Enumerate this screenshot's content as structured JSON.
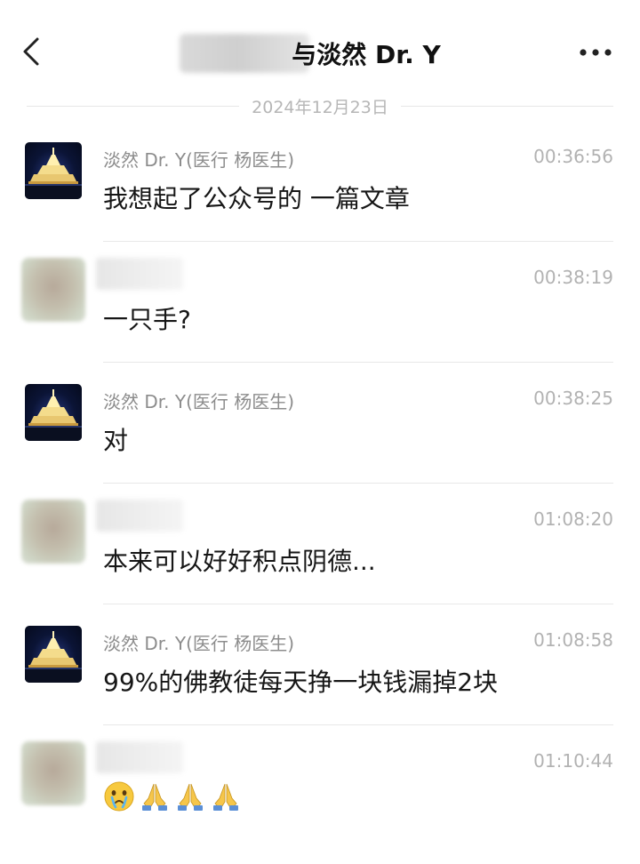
{
  "header": {
    "contact_suffix": "与淡然 Dr. Y",
    "back_icon": "chevron-left-icon",
    "more_icon": "more-dots-icon"
  },
  "date_divider": "2024年12月23日",
  "messages": [
    {
      "sender": "淡然 Dr. Y(医行 杨医生)",
      "time": "00:36:56",
      "text": "我想起了公众号的 一篇文章",
      "avatar": "night-temple"
    },
    {
      "sender": "",
      "time": "00:38:19",
      "text": "一只手?",
      "avatar": "blurred"
    },
    {
      "sender": "淡然 Dr. Y(医行 杨医生)",
      "time": "00:38:25",
      "text": "对",
      "avatar": "night-temple"
    },
    {
      "sender": "",
      "time": "01:08:20",
      "text": "本来可以好好积点阴德...",
      "avatar": "blurred"
    },
    {
      "sender": "淡然 Dr. Y(医行 杨医生)",
      "time": "01:08:58",
      "text": "99%的佛教徒每天挣一块钱漏掉2块",
      "avatar": "night-temple"
    },
    {
      "sender": "",
      "time": "01:10:44",
      "text": "",
      "avatar": "blurred",
      "emojis": [
        "crying-face-icon",
        "folded-hands-icon",
        "folded-hands-icon",
        "folded-hands-icon"
      ]
    }
  ],
  "colors": {
    "text_primary": "#161616",
    "text_secondary": "#8c8c8c",
    "text_time": "#b2b2b2",
    "divider": "#e8e8e8"
  }
}
